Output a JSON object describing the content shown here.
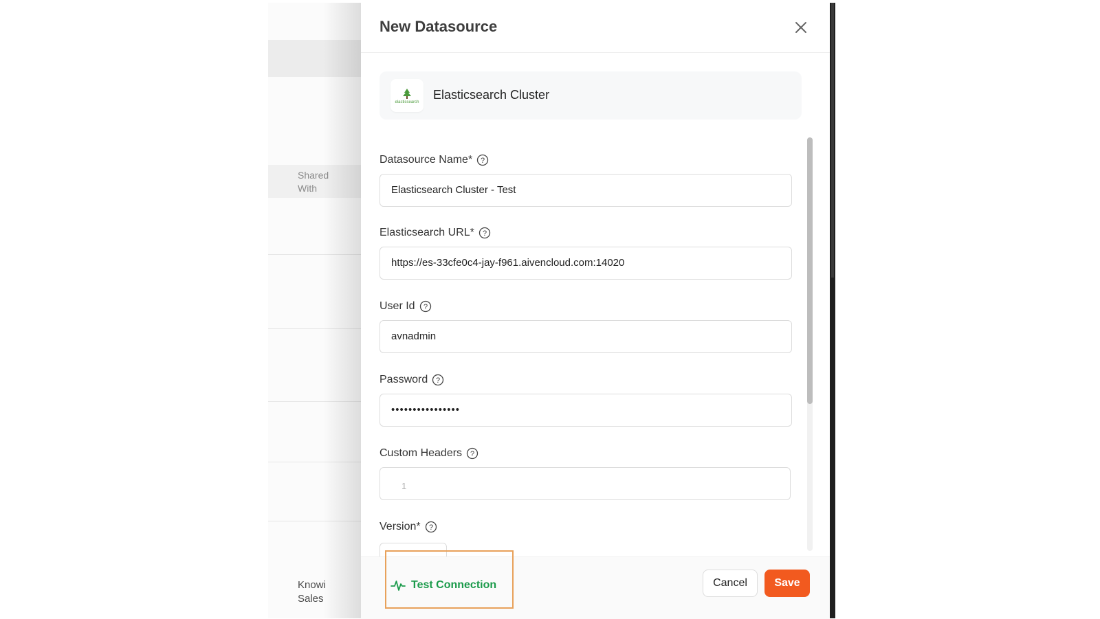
{
  "background": {
    "column_header": "Shared With",
    "bottom_label": "Knowi Sales"
  },
  "dialog": {
    "title": "New Datasource",
    "source_name": "Elasticsearch Cluster",
    "logo_text": "elasticsearch",
    "fields": {
      "datasource_name": {
        "label": "Datasource Name*",
        "value": "Elasticsearch Cluster - Test"
      },
      "elasticsearch_url": {
        "label": "Elasticsearch URL*",
        "value": "https://es-33cfe0c4-jay-f961.aivencloud.com:14020"
      },
      "user_id": {
        "label": "User Id",
        "value": "avnadmin"
      },
      "password": {
        "label": "Password",
        "value": "••••••••••••••••"
      },
      "custom_headers": {
        "label": "Custom Headers",
        "line_number": "1"
      },
      "version": {
        "label": "Version*"
      }
    },
    "footer": {
      "test_connection": "Test Connection",
      "cancel": "Cancel",
      "save": "Save"
    }
  },
  "colors": {
    "accent_save": "#f25a1f",
    "test_connection": "#1a9a4a",
    "highlight": "#e8a15a"
  },
  "icons": [
    "close-icon",
    "help-icon",
    "elasticsearch-logo",
    "pulse-icon"
  ]
}
